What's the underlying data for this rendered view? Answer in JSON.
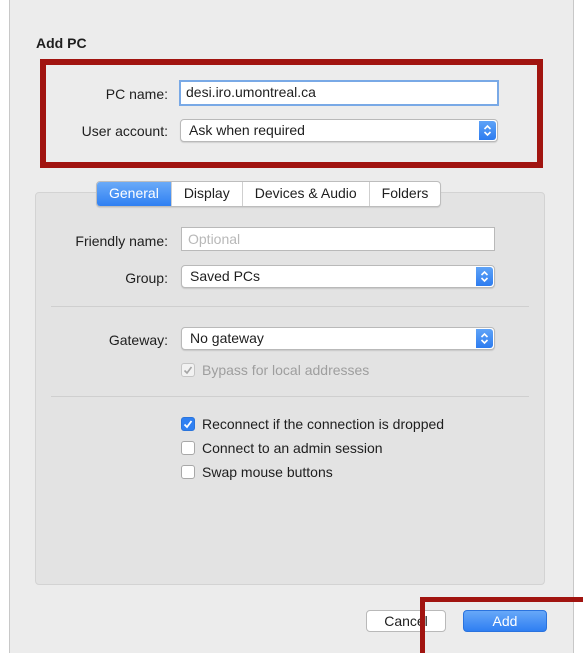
{
  "dialog": {
    "title": "Add PC",
    "pc_name_label": "PC name:",
    "pc_name_value": "desi.iro.umontreal.ca",
    "user_account_label": "User account:",
    "user_account_value": "Ask when required"
  },
  "tabs": [
    "General",
    "Display",
    "Devices & Audio",
    "Folders"
  ],
  "general": {
    "friendly_name_label": "Friendly name:",
    "friendly_name_placeholder": "Optional",
    "group_label": "Group:",
    "group_value": "Saved PCs",
    "gateway_label": "Gateway:",
    "gateway_value": "No gateway",
    "bypass_label": "Bypass for local addresses",
    "reconnect_label": "Reconnect if the connection is dropped",
    "admin_session_label": "Connect to an admin session",
    "swap_mouse_label": "Swap mouse buttons"
  },
  "states": {
    "bypass_checked": true,
    "bypass_enabled": false,
    "reconnect_checked": true,
    "admin_session_checked": false,
    "swap_mouse_checked": false
  },
  "buttons": {
    "cancel_label": "Cancel",
    "add_label": "Add"
  },
  "colors": {
    "annotation_red": "#a11410",
    "accent_blue": "#2f80f2"
  },
  "icons": {
    "popup_arrows": "up-down-chevrons-icon",
    "checkmark": "checkmark-icon"
  }
}
